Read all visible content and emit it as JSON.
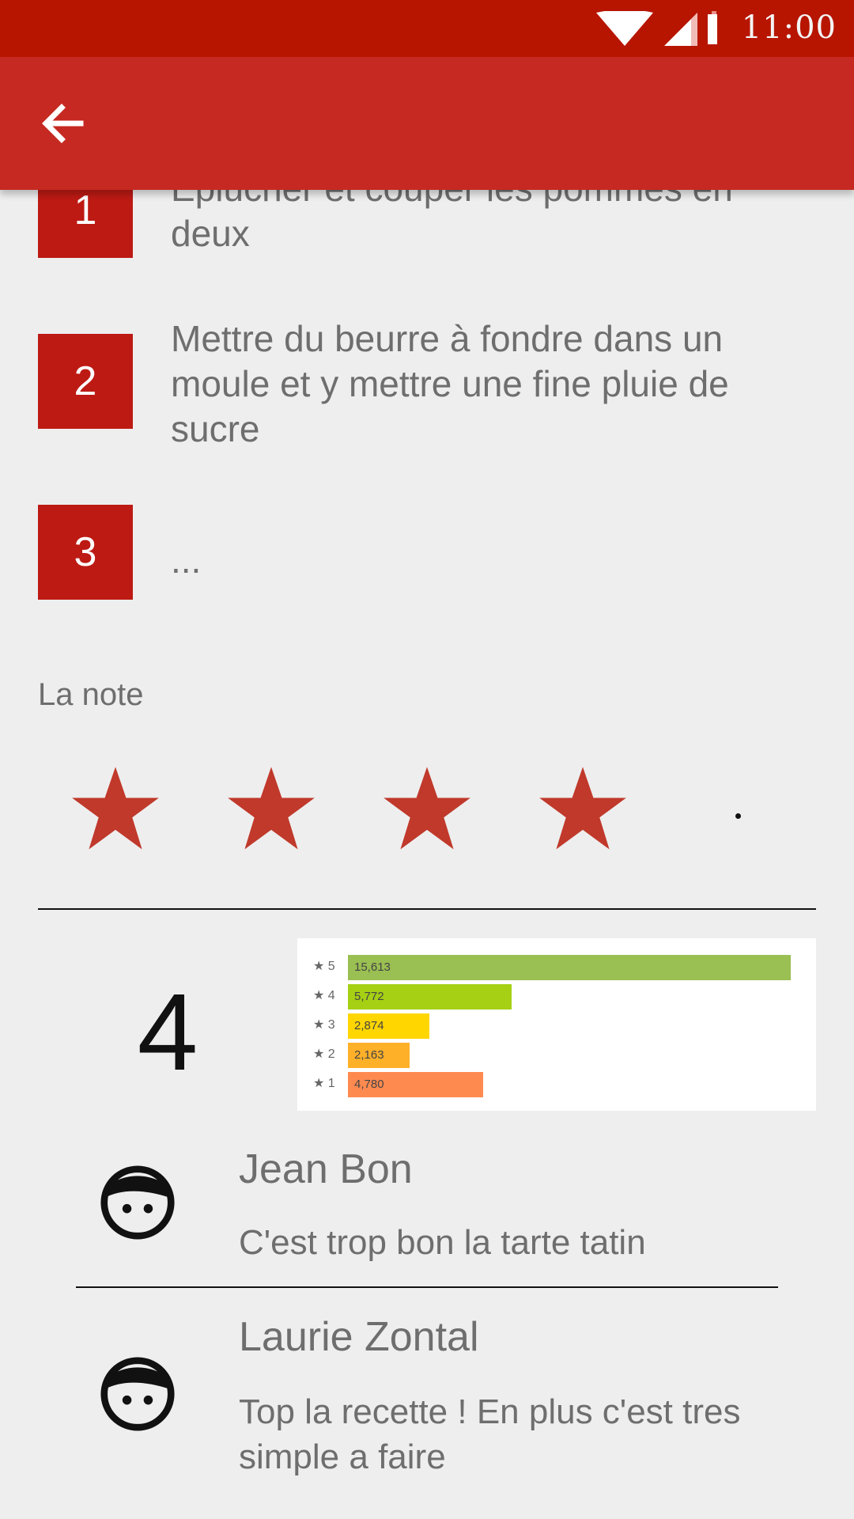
{
  "status_bar": {
    "time": "11:00",
    "icons": [
      "wifi-icon",
      "signal-icon",
      "battery-icon"
    ],
    "background": "#b71500"
  },
  "app_bar": {
    "back_icon": "arrow-left-icon",
    "background": "#c62921"
  },
  "steps": [
    {
      "number": "1",
      "text": "Eplucher et couper les pommes en deux"
    },
    {
      "number": "2",
      "text": "Mettre du beurre à fondre dans un moule et y mettre une fine pluie de sucre"
    },
    {
      "number": "3",
      "text": "..."
    }
  ],
  "rating": {
    "label": "La note",
    "stars_filled": 4,
    "stars_total": 5,
    "star_color": "#c0392b",
    "average": "4"
  },
  "histogram": [
    {
      "stars": "5",
      "value": "15,613",
      "count": 15613,
      "color": "#9abf52"
    },
    {
      "stars": "4",
      "value": "5,772",
      "count": 5772,
      "color": "#a5d014"
    },
    {
      "stars": "3",
      "value": "2,874",
      "count": 2874,
      "color": "#ffd600"
    },
    {
      "stars": "2",
      "value": "2,163",
      "count": 2163,
      "color": "#ffb029"
    },
    {
      "stars": "1",
      "value": "4,780",
      "count": 4780,
      "color": "#ff8a50"
    }
  ],
  "reviews": [
    {
      "name": "Jean Bon",
      "text": "C'est trop bon la tarte tatin",
      "icon": "face-icon"
    },
    {
      "name": "Laurie Zontal",
      "text": "Top la recette ! En plus c'est tres simple a faire",
      "icon": "face-icon"
    }
  ]
}
